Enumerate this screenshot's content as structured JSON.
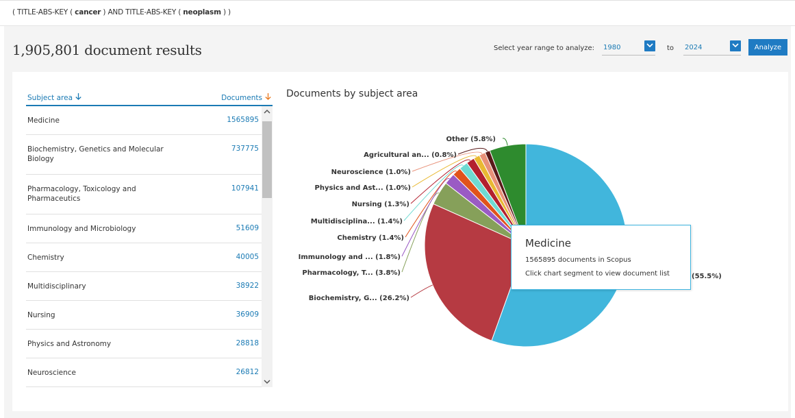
{
  "query": {
    "prefix": "( TITLE-ABS-KEY ( ",
    "term1": "cancer",
    "mid": " )  AND  TITLE-ABS-KEY ( ",
    "term2": "neoplasm",
    "suffix": " ) )"
  },
  "results": {
    "count_label": "1,905,801 document results"
  },
  "year_range": {
    "label": "Select year range to analyze:",
    "from": "1980",
    "to_label": "to",
    "to": "2024",
    "analyze_label": "Analyze"
  },
  "table": {
    "col_subject": "Subject area",
    "col_documents": "Documents",
    "rows": [
      {
        "name": "Medicine",
        "count": "1565895"
      },
      {
        "name": "Biochemistry, Genetics and Molecular Biology",
        "count": "737775"
      },
      {
        "name": "Pharmacology, Toxicology and Pharmaceutics",
        "count": "107941"
      },
      {
        "name": "Immunology and Microbiology",
        "count": "51609"
      },
      {
        "name": "Chemistry",
        "count": "40005"
      },
      {
        "name": "Multidisciplinary",
        "count": "38922"
      },
      {
        "name": "Nursing",
        "count": "36909"
      },
      {
        "name": "Physics and Astronomy",
        "count": "28818"
      },
      {
        "name": "Neuroscience",
        "count": "26812"
      }
    ]
  },
  "chart_data": {
    "type": "pie",
    "title": "Documents by subject area",
    "slices": [
      {
        "label": "Medicine",
        "display": "(55.5%)",
        "value": 55.5,
        "color": "#41b6dc"
      },
      {
        "label": "Biochemistry, G...",
        "display": "Biochemistry, G... (26.2%)",
        "value": 26.2,
        "color": "#b63a42"
      },
      {
        "label": "Pharmacology, T...",
        "display": "Pharmacology, T... (3.8%)",
        "value": 3.8,
        "color": "#86a05a"
      },
      {
        "label": "Immunology and ...",
        "display": "Immunology and ... (1.8%)",
        "value": 1.8,
        "color": "#9a5bc4"
      },
      {
        "label": "Chemistry",
        "display": "Chemistry (1.4%)",
        "value": 1.4,
        "color": "#e1531b"
      },
      {
        "label": "Multidisciplina...",
        "display": "Multidisciplina... (1.4%)",
        "value": 1.4,
        "color": "#6fdad2"
      },
      {
        "label": "Nursing",
        "display": "Nursing (1.3%)",
        "value": 1.3,
        "color": "#b3202f"
      },
      {
        "label": "Physics and Ast...",
        "display": "Physics and Ast... (1.0%)",
        "value": 1.0,
        "color": "#e9b933"
      },
      {
        "label": "Neuroscience",
        "display": "Neuroscience (1.0%)",
        "value": 1.0,
        "color": "#e89179"
      },
      {
        "label": "Agricultural an...",
        "display": "Agricultural an... (0.8%)",
        "value": 0.8,
        "color": "#5a1a1a"
      },
      {
        "label": "Other",
        "display": "Other (5.8%)",
        "value": 5.8,
        "color": "#2e8b2e"
      }
    ]
  },
  "tooltip": {
    "title": "Medicine",
    "line1": "1565895 documents in Scopus",
    "line2": "Click chart segment to view document list"
  }
}
